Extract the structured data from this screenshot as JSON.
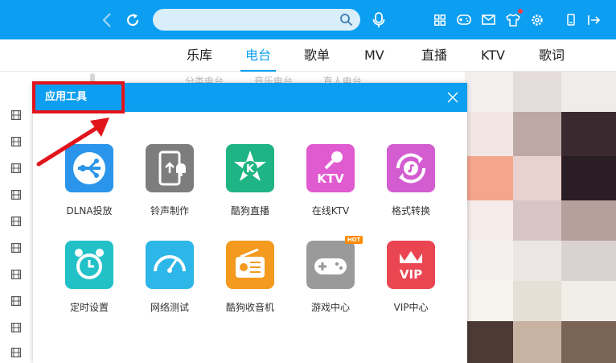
{
  "colors": {
    "accent": "#0c9ef0",
    "highlight_box": "#e2141b"
  },
  "topbar": {
    "icons": [
      "back-icon",
      "refresh-icon",
      "search-icon",
      "voice-icon",
      "apps-icon",
      "game-icon",
      "mail-icon",
      "skin-icon",
      "settings-icon",
      "mini-player-icon",
      "exit-icon"
    ]
  },
  "nav": {
    "tabs": [
      {
        "label": "乐库"
      },
      {
        "label": "电台"
      },
      {
        "label": "歌单"
      },
      {
        "label": "MV"
      },
      {
        "label": "直播"
      },
      {
        "label": "KTV"
      },
      {
        "label": "歌词"
      }
    ],
    "active_tab": "电台"
  },
  "subtabs": [
    "分类电台",
    "音乐电台",
    "直人电台"
  ],
  "dialog": {
    "title": "应用工具",
    "tools": [
      {
        "label": "DLNA投放",
        "icon": "dlna-icon"
      },
      {
        "label": "铃声制作",
        "icon": "ringtone-icon"
      },
      {
        "label": "酷狗直播",
        "icon": "kugou-live-icon"
      },
      {
        "label": "在线KTV",
        "icon": "ktv-mic-icon"
      },
      {
        "label": "格式转换",
        "icon": "format-convert-icon"
      },
      {
        "label": "定时设置",
        "icon": "alarm-clock-icon"
      },
      {
        "label": "网络测试",
        "icon": "speed-gauge-icon"
      },
      {
        "label": "酷狗收音机",
        "icon": "radio-icon"
      },
      {
        "label": "游戏中心",
        "icon": "gamepad-icon",
        "badge": "HOT"
      },
      {
        "label": "VIP中心",
        "icon": "vip-crown-icon"
      }
    ]
  }
}
